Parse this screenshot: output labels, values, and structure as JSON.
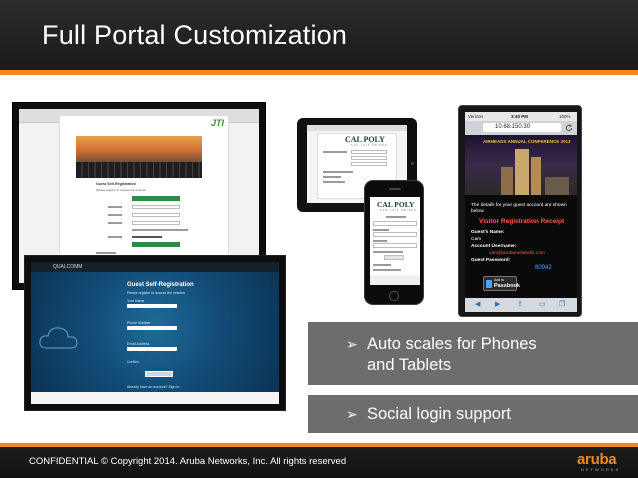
{
  "slide": {
    "title": "Full Portal Customization",
    "bullets": [
      {
        "marker": "➢",
        "line1": "Auto scales for Phones",
        "line2": "and Tablets"
      },
      {
        "marker": "➢",
        "line1": "Social login support"
      }
    ],
    "footer": "CONFIDENTIAL © Copyright 2014. Aruba Networks, Inc. All rights reserved",
    "logo": {
      "word": "aruba",
      "sub": "NETWORKS"
    }
  },
  "colors": {
    "accent": "#f6871f",
    "header_bg": "#222222",
    "callout_bg": "#6d6d6d"
  },
  "shot_laptop1": {
    "logo": "JTI",
    "heading": "Guest Self-Registration",
    "sub": "Please register to access the network",
    "link": "Already have an account? Sign In"
  },
  "shot_laptop2": {
    "brand": "QUALCOMM",
    "heading": "Guest Self-Registration",
    "sub": "Please register to access the network",
    "labels": [
      "Your Name",
      "Phone Number",
      "Email Address"
    ],
    "confirm": "Confirm",
    "button": "Register",
    "link": "Already have an account? Sign In"
  },
  "shot_tablet": {
    "brand": "CAL POLY",
    "brand_sub": "SAN LUIS OBISPO"
  },
  "shot_phone": {
    "brand": "CAL POLY",
    "brand_sub": "SAN LUIS OBISPO"
  },
  "shot_tall_phone": {
    "carrier": "Verizon",
    "time": "3:40 PM",
    "battery": "100%",
    "url": "10.68.150.30",
    "event": "AIRHEADS ANNUAL CONFERENCE 2013",
    "intro": "The details for your guest account are shown below.",
    "receipt": "Visitor Registration Receipt",
    "name_label": "Guest's Name:",
    "name_value": "Cam",
    "user_label": "Account Username:",
    "user_value": "cam@arubanetworks.com",
    "pass_label": "Guest Password:",
    "pass_value": "80942",
    "passbook_add": "Add to",
    "passbook": "Passbook"
  }
}
